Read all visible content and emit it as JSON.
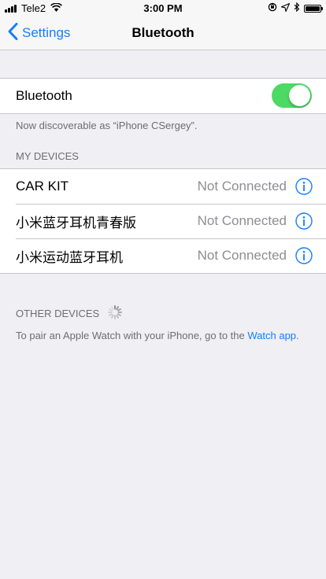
{
  "status_bar": {
    "carrier": "Tele2",
    "time": "3:00 PM",
    "icons": [
      "signal-bars-icon",
      "wifi-icon",
      "orientation-lock-icon",
      "location-arrow-icon",
      "bluetooth-icon",
      "battery-icon"
    ]
  },
  "nav": {
    "back_label": "Settings",
    "title": "Bluetooth"
  },
  "bluetooth": {
    "label": "Bluetooth",
    "enabled": true,
    "discoverable_text": "Now discoverable as “iPhone CSergey”."
  },
  "my_devices": {
    "header": "MY DEVICES",
    "devices": [
      {
        "name": "CAR KIT",
        "status": "Not Connected"
      },
      {
        "name": "小米蓝牙耳机青春版",
        "status": "Not Connected"
      },
      {
        "name": "小米运动蓝牙耳机",
        "status": "Not Connected"
      }
    ]
  },
  "other_devices": {
    "header": "OTHER DEVICES",
    "footer_text": "To pair an Apple Watch with your iPhone, go to the ",
    "footer_link": "Watch app",
    "footer_end": "."
  },
  "colors": {
    "accent": "#157efb",
    "toggle_on": "#4cd964",
    "background": "#efeff4",
    "secondary_text": "#8e8e93"
  }
}
